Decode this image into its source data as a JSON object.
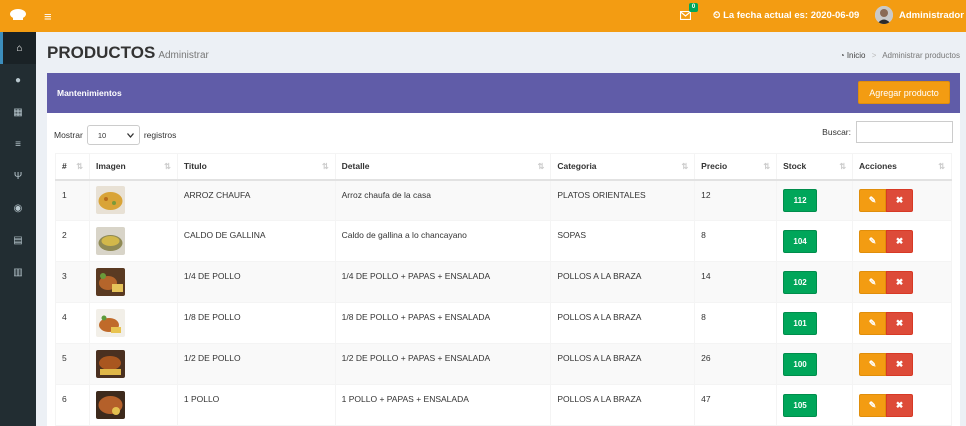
{
  "header": {
    "mail_badge": "0",
    "date_text": "La fecha actual es: 2020-06-09",
    "user_name": "Administrador"
  },
  "sidebar": {
    "icons": [
      "home-icon",
      "user-icon",
      "grid-icon",
      "list-icon",
      "utensils-icon",
      "compass-icon",
      "calculator-icon",
      "bar-chart-icon"
    ]
  },
  "page": {
    "title": "PRODUCTOS",
    "subtitle": "Administrar",
    "breadcrumb_home": "Inicio",
    "breadcrumb_current": "Administrar productos"
  },
  "box": {
    "title": "Mantenimientos",
    "add_button": "Agregar producto"
  },
  "controls": {
    "show_label": "Mostrar",
    "page_size": "10",
    "records_label": "registros",
    "search_label": "Buscar:"
  },
  "table": {
    "columns": [
      "#",
      "Imagen",
      "Titulo",
      "Detalle",
      "Categoria",
      "Precio",
      "Stock",
      "Acciones"
    ],
    "rows": [
      {
        "id": "1",
        "title": "ARROZ CHAUFA",
        "detail": "Arroz chaufa de la casa",
        "category": "PLATOS ORIENTALES",
        "price": "12",
        "stock": "112"
      },
      {
        "id": "2",
        "title": "CALDO DE GALLINA",
        "detail": "Caldo de gallina a lo chancayano",
        "category": "SOPAS",
        "price": "8",
        "stock": "104"
      },
      {
        "id": "3",
        "title": "1/4 DE POLLO",
        "detail": "1/4 DE POLLO + PAPAS + ENSALADA",
        "category": "POLLOS A LA BRAZA",
        "price": "14",
        "stock": "102"
      },
      {
        "id": "4",
        "title": "1/8 DE POLLO",
        "detail": "1/8 DE POLLO + PAPAS + ENSALADA",
        "category": "POLLOS A LA BRAZA",
        "price": "8",
        "stock": "101"
      },
      {
        "id": "5",
        "title": "1/2 DE POLLO",
        "detail": "1/2 DE POLLO + PAPAS + ENSALADA",
        "category": "POLLOS A LA BRAZA",
        "price": "26",
        "stock": "100"
      },
      {
        "id": "6",
        "title": "1 POLLO",
        "detail": "1 POLLO + PAPAS + ENSALADA",
        "category": "POLLOS A LA BRAZA",
        "price": "47",
        "stock": "105"
      }
    ]
  },
  "colors": {
    "topbar": "#f39c12",
    "sidebar": "#222d32",
    "box_header": "#605ca8",
    "stock_badge": "#00a65a",
    "delete_button": "#dd4b39"
  }
}
